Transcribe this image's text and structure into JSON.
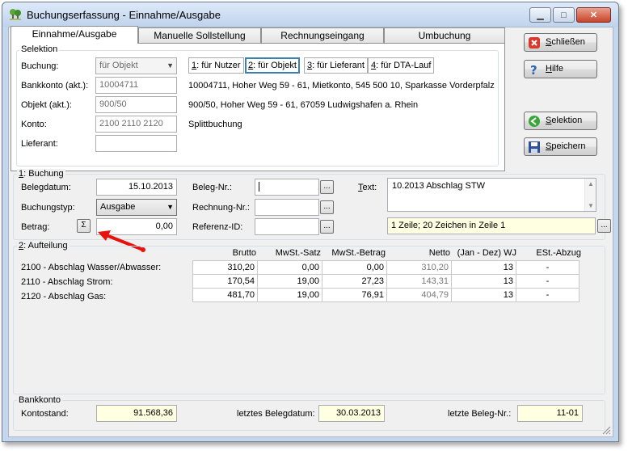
{
  "window": {
    "title": "Buchungserfassung - Einnahme/Ausgabe",
    "minimize_glyph": "▁",
    "maximize_glyph": "□",
    "close_glyph": "✕"
  },
  "tabs": [
    "Einnahme/Ausgabe",
    "Manuelle Sollstellung",
    "Rechnungseingang",
    "Umbuchung"
  ],
  "selektion": {
    "group_label": "Selektion",
    "buchung_label": "Buchung:",
    "buchung_value": "für Objekt",
    "bankkonto_label": "Bankkonto (akt.):",
    "bankkonto_value": "10004711",
    "objekt_label": "Objekt (akt.):",
    "objekt_value": "900/50",
    "konto_label": "Konto:",
    "konto_value": "2100 2110 2120",
    "lieferant_label": "Lieferant:",
    "lieferant_value": "",
    "options": [
      {
        "key": "1",
        "text": ": für Nutzer"
      },
      {
        "key": "2",
        "text": ": für Objekt"
      },
      {
        "key": "3",
        "text": ": für Lieferant"
      },
      {
        "key": "4",
        "text": ": für DTA-Lauf"
      }
    ],
    "bankkonto_info": "10004711,  Hoher Weg 59 - 61,  Mietkonto,  545 500 10,  Sparkasse Vorderpfalz",
    "objekt_info": "900/50,  Hoher Weg 59 - 61, 67059 Ludwigshafen a. Rhein",
    "konto_info": "Splittbuchung"
  },
  "side_buttons": {
    "schliessen_u": "S",
    "schliessen_rest": "chließen",
    "hilfe_u": "H",
    "hilfe_rest": "ilfe",
    "selektion_u": "S",
    "selektion_rest": "elektion",
    "speichern_u": "S",
    "speichern_rest": "peichern"
  },
  "buchung": {
    "group_key": "1",
    "group_rest": ": Buchung",
    "belegdatum_label": "Belegdatum:",
    "belegdatum_value": "15.10.2013",
    "buchungstyp_label": "Buchungstyp:",
    "buchungstyp_value": "Ausgabe",
    "betrag_label": "Betrag:",
    "betrag_value": "0,00",
    "sigma_label": "Σ",
    "belegnr_label": "Beleg-Nr.:",
    "belegnr_value": "",
    "rechnungnr_label": "Rechnung-Nr.:",
    "rechnungnr_value": "",
    "referenzid_label": "Referenz-ID:",
    "referenzid_value": "",
    "ellipsis": "...",
    "text_label_u": "T",
    "text_label_rest": "ext:",
    "text_value": "10.2013 Abschlag STW",
    "text_status": "1 Zeile; 20 Zeichen in Zeile 1"
  },
  "aufteilung": {
    "group_key": "2",
    "group_rest": ": Aufteilung",
    "columns": [
      "Brutto",
      "MwSt.-Satz",
      "MwSt.-Betrag",
      "Netto",
      "(Jan - Dez) WJ",
      "ESt.-Abzug"
    ],
    "rows": [
      {
        "label": "2100 - Abschlag Wasser/Abwasser:",
        "brutto": "310,20",
        "satz": "0,00",
        "betrag": "0,00",
        "netto": "310,20",
        "wj": "13",
        "est": "-"
      },
      {
        "label": "2110 - Abschlag Strom:",
        "brutto": "170,54",
        "satz": "19,00",
        "betrag": "27,23",
        "netto": "143,31",
        "wj": "13",
        "est": "-"
      },
      {
        "label": "2120 - Abschlag Gas:",
        "brutto": "481,70",
        "satz": "19,00",
        "betrag": "76,91",
        "netto": "404,79",
        "wj": "13",
        "est": "-"
      }
    ]
  },
  "bankkonto": {
    "group_label": "Bankkonto",
    "kontostand_label": "Kontostand:",
    "kontostand_value": "91.568,36",
    "letztes_belegdatum_label": "letztes Belegdatum:",
    "letztes_belegdatum_value": "30.03.2013",
    "letzte_belegnr_label": "letzte Beleg-Nr.:",
    "letzte_belegnr_value": "11-01"
  },
  "colors": {
    "accent_red": "#e8120c",
    "highlight_yellow": "#ffffe1"
  }
}
